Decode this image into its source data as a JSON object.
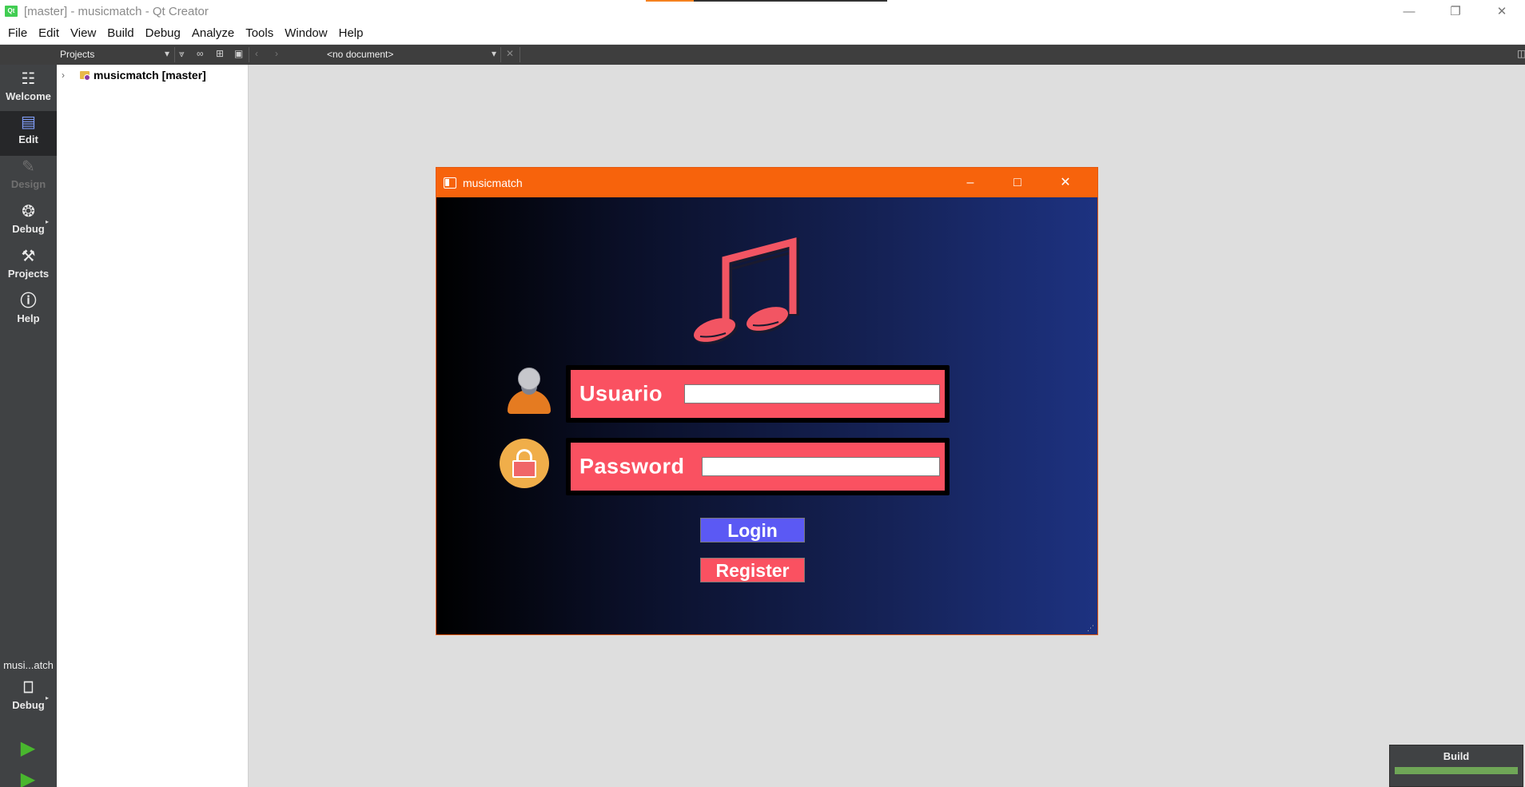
{
  "window": {
    "title": "[master] - musicmatch - Qt Creator",
    "app_logo": "Qt",
    "controls": [
      "minimize-icon",
      "restore-icon",
      "close-icon"
    ]
  },
  "menu": [
    "File",
    "Edit",
    "View",
    "Build",
    "Debug",
    "Analyze",
    "Tools",
    "Window",
    "Help"
  ],
  "toolbar": {
    "projects_label": "Projects",
    "document_label": "<no document>"
  },
  "modes": [
    {
      "label": "Welcome",
      "icon": "grid-icon"
    },
    {
      "label": "Edit",
      "icon": "edit-document-icon"
    },
    {
      "label": "Design",
      "icon": "pencil-icon"
    },
    {
      "label": "Debug",
      "icon": "bug-icon"
    },
    {
      "label": "Projects",
      "icon": "wrench-icon"
    },
    {
      "label": "Help",
      "icon": "help-icon"
    }
  ],
  "kit": {
    "project_label": "musi...atch",
    "build_config": "Debug"
  },
  "project_tree": {
    "root": "musicmatch [master]"
  },
  "app": {
    "title": "musicmatch",
    "username_label": "Usuario",
    "password_label": "Password",
    "username_value": "",
    "password_value": "",
    "login_label": "Login",
    "register_label": "Register",
    "colors": {
      "titlebar": "#f7630c",
      "field_bg": "#fa5161",
      "login_bg": "#5b59f4",
      "register_bg": "#fa5161",
      "note": "#f25563"
    }
  },
  "build_indicator": {
    "label": "Build",
    "progress": 1.0
  }
}
